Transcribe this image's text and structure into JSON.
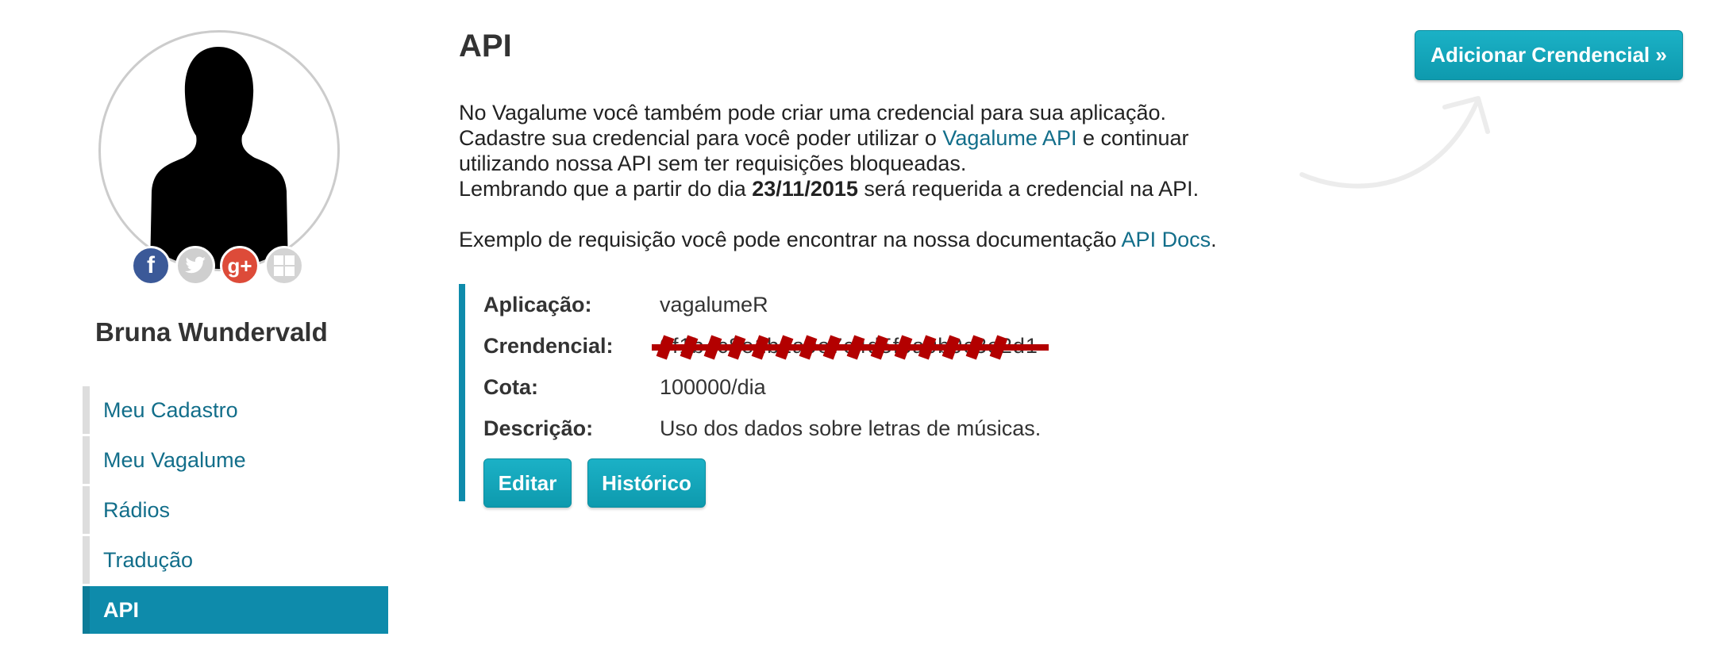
{
  "profile": {
    "name": "Bruna Wundervald",
    "social": [
      {
        "icon": "facebook-icon",
        "glyph": "f",
        "color": "#3b5998"
      },
      {
        "icon": "twitter-icon",
        "glyph": "",
        "color": "#cfcfcf"
      },
      {
        "icon": "google-plus-icon",
        "glyph": "g+",
        "color": "#dd4b39"
      },
      {
        "icon": "windows-icon",
        "glyph": "",
        "color": "#d4d4d4"
      }
    ]
  },
  "sidebar": {
    "items": [
      {
        "label": "Meu Cadastro",
        "active": false
      },
      {
        "label": "Meu Vagalume",
        "active": false
      },
      {
        "label": "Rádios",
        "active": false
      },
      {
        "label": "Tradução",
        "active": false
      },
      {
        "label": "API",
        "active": true
      }
    ]
  },
  "main": {
    "title": "API",
    "add_button": "Adicionar Crendencial »",
    "intro": {
      "line1": "No Vagalume você também pode criar uma credencial para sua aplicação.",
      "line2_before": "Cadastre sua credencial para você poder utilizar o ",
      "line2_link": "Vagalume API",
      "line2_after": " e continuar",
      "line3": "utilizando nossa API sem ter requisições bloqueadas.",
      "line4_before": "Lembrando que a partir do dia ",
      "line4_date": "23/11/2015",
      "line4_after": " será requerida a credencial na API.",
      "line5_before": "Exemplo de requisição você pode encontrar na nossa documentação ",
      "line5_link": "API Docs",
      "line5_after": "."
    },
    "credential": {
      "app_label": "Aplicação:",
      "app_value": "vagalumeR",
      "key_label": "Crendencial:",
      "key_value": "0f1b4c8e1b2a9e7c4d5f6a0b9c3e2d1",
      "quota_label": "Cota:",
      "quota_value": "100000/dia",
      "desc_label": "Descrição:",
      "desc_value": "Uso dos dados sobre letras de músicas.",
      "edit_button": "Editar",
      "history_button": "Histórico"
    }
  },
  "colors": {
    "accent": "#0e8bab",
    "link": "#126e8a",
    "redaction": "#b30000"
  }
}
